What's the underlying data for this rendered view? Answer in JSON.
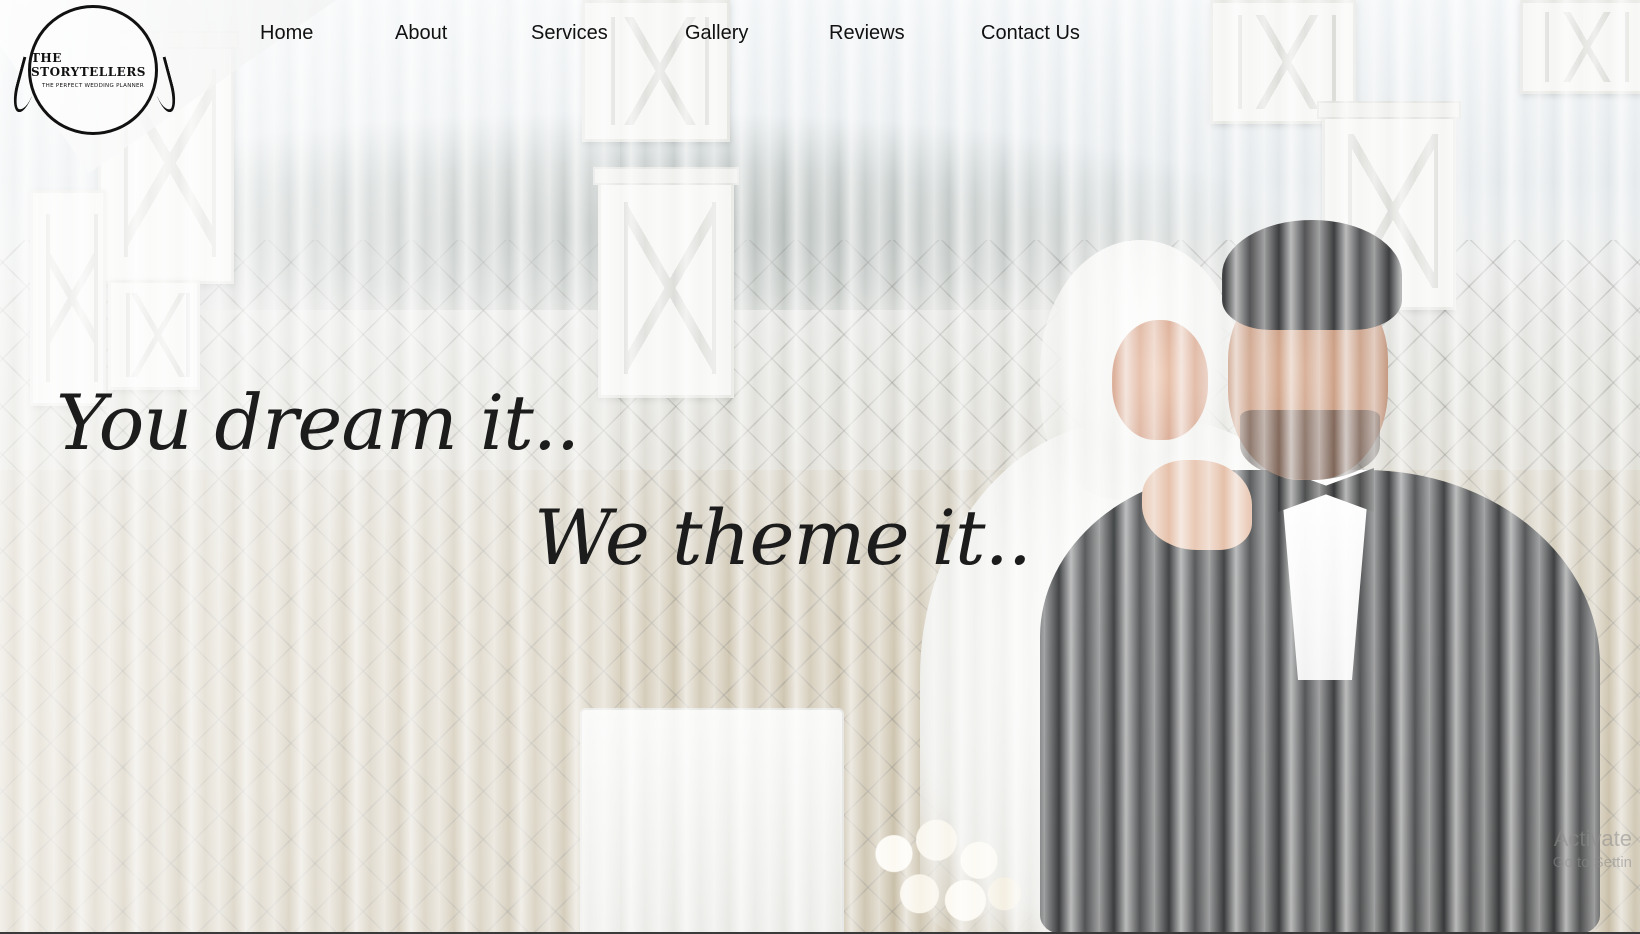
{
  "logo": {
    "title": "THE STORYTELLERS",
    "tagline": "THE PERFECT WEDDING PLANNER"
  },
  "nav": {
    "items": [
      {
        "label": "Home"
      },
      {
        "label": "About"
      },
      {
        "label": "Services"
      },
      {
        "label": "Gallery"
      },
      {
        "label": "Reviews"
      },
      {
        "label": "Contact Us"
      }
    ]
  },
  "hero": {
    "line1": "You dream it..",
    "line2": "We theme it.."
  },
  "watermark": {
    "title": "Activate",
    "subtitle": "Go to Settin"
  },
  "colors": {
    "text": "#111111",
    "tagline": "#1c1c1c"
  }
}
